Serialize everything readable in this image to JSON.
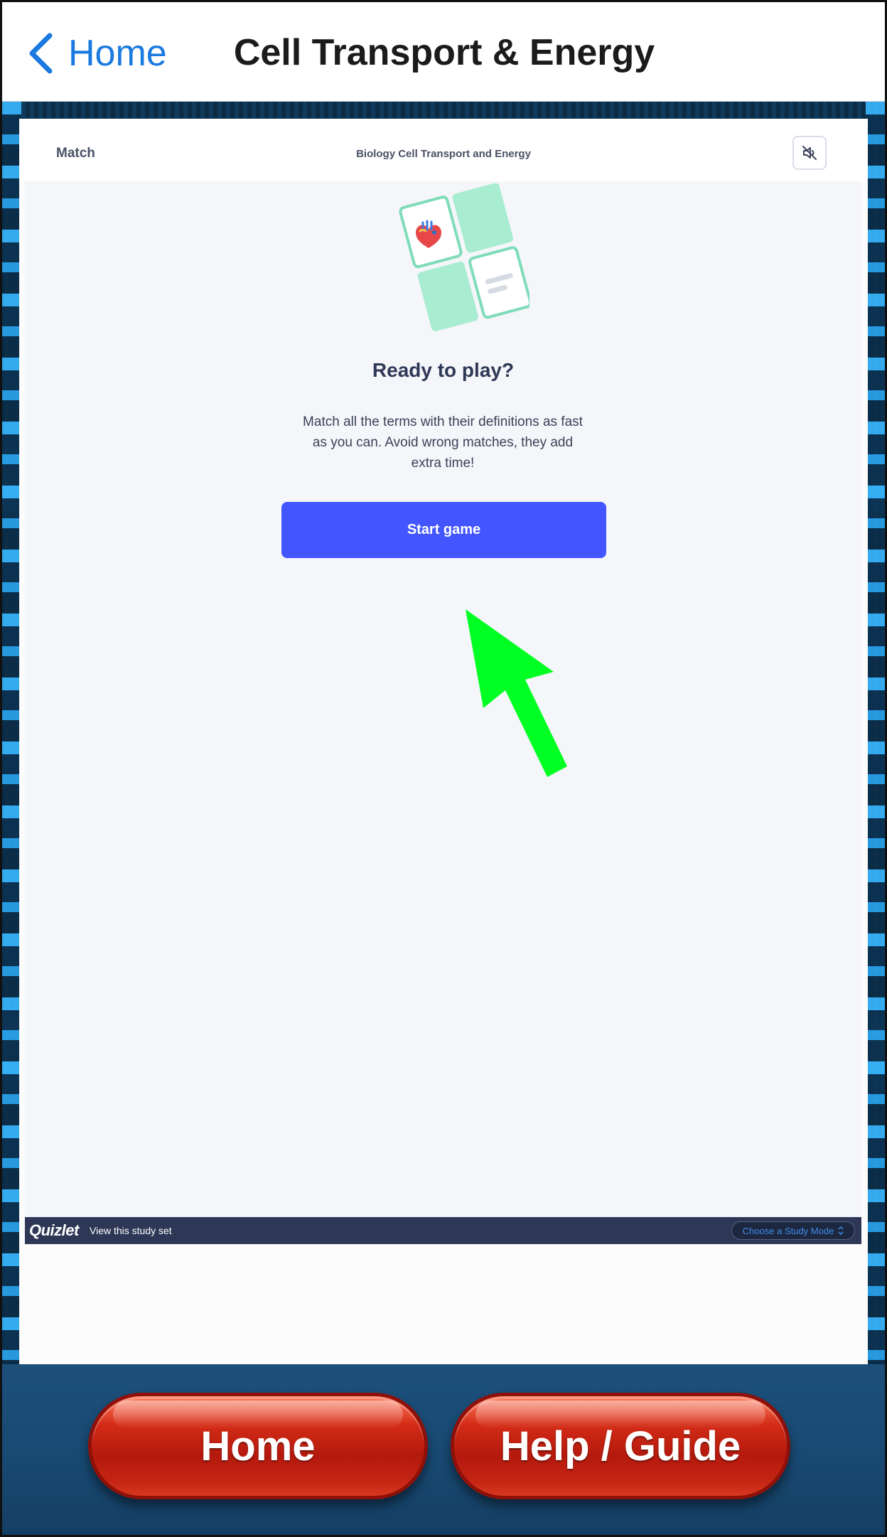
{
  "nav": {
    "back_label": "Home",
    "title": "Cell Transport & Energy"
  },
  "quiz": {
    "mode_label": "Match",
    "set_title": "Biology Cell Transport and Energy",
    "mute_icon": "speaker-muted-icon",
    "heading": "Ready to play?",
    "instructions": "Match all the terms with their definitions as fast as you can. Avoid wrong matches, they add extra time!",
    "start_button": "Start game",
    "accent_color": "#4255ff"
  },
  "quizlet_bar": {
    "logo": "Quizlet",
    "link": "View this study set",
    "study_mode": "Choose a Study Mode"
  },
  "bottom": {
    "home_button": "Home",
    "help_button": "Help / Guide"
  },
  "overlay": {
    "pointer_arrow_color": "#00ff22"
  }
}
